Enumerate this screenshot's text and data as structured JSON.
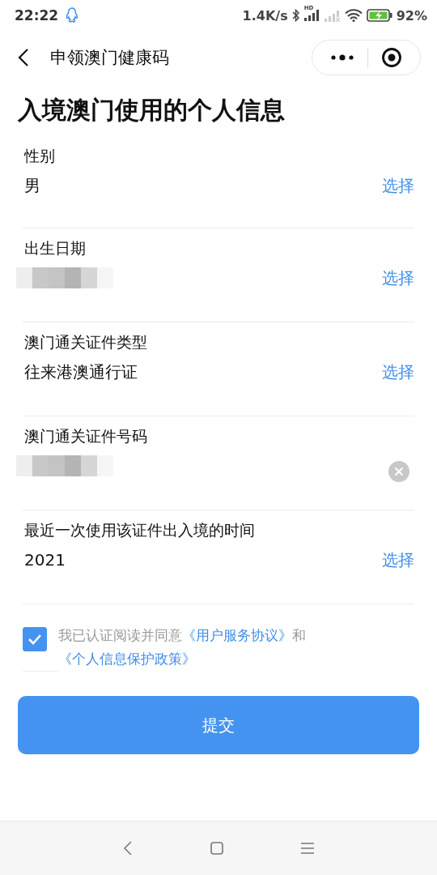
{
  "status_bar": {
    "time": "22:22",
    "speed": "1.4K/s",
    "network": "HD",
    "battery": "92%"
  },
  "nav": {
    "title": "申领澳门健康码"
  },
  "heading": "入境澳门使用的个人信息",
  "fields": [
    {
      "label": "性别",
      "kind": "select",
      "value": "男",
      "action": "选择"
    },
    {
      "label": "出生日期",
      "kind": "select",
      "redacted": true,
      "action": "选择"
    },
    {
      "label": "澳门通关证件类型",
      "kind": "select",
      "value": "往来港澳通行证",
      "action": "选择"
    },
    {
      "label": "澳门通关证件号码",
      "kind": "input",
      "redacted": true
    },
    {
      "label": "最近一次使用该证件出入境的时间",
      "kind": "select",
      "value": "2021",
      "action": "选择"
    }
  ],
  "agreement": {
    "checked": true,
    "parts": [
      {
        "text": "我已认证阅读并同意",
        "link": false
      },
      {
        "text": "《用户服务协议》",
        "link": true
      },
      {
        "text": "和",
        "link": false
      },
      {
        "text": "《个人信息保护政策》",
        "link": true
      }
    ]
  },
  "submit": "提交"
}
